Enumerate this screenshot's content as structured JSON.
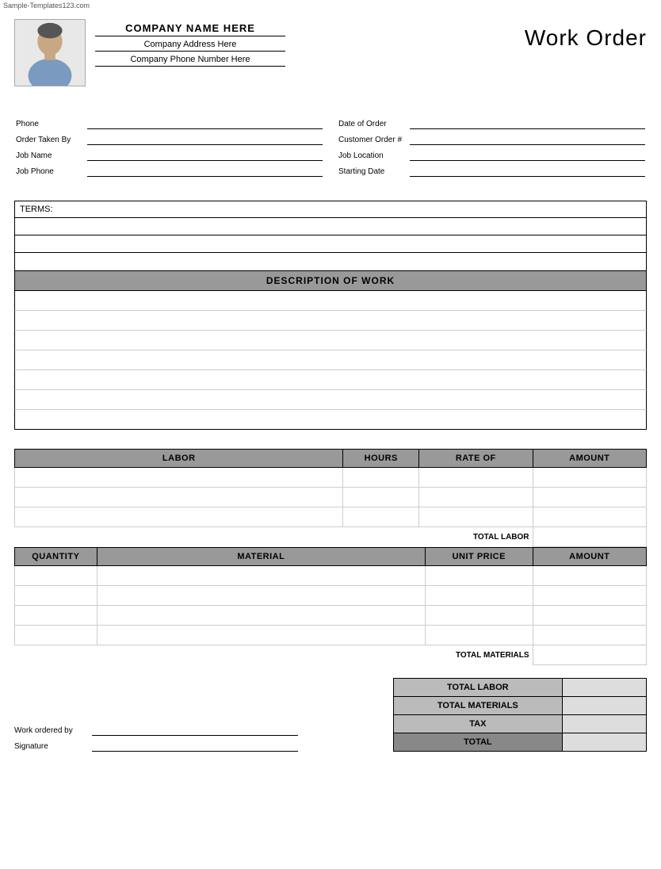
{
  "watermark": "Sample-Templates123.com",
  "header": {
    "company_name": "COMPANY NAME HERE",
    "company_address": "Company Address Here",
    "company_phone": "Company Phone Number Here",
    "title": "Work Order"
  },
  "form": {
    "left": [
      {
        "label": "Phone",
        "value": ""
      },
      {
        "label": "Order Taken By",
        "value": ""
      },
      {
        "label": "Job Name",
        "value": ""
      },
      {
        "label": "Job Phone",
        "value": ""
      }
    ],
    "right": [
      {
        "label": "Date of Order",
        "value": ""
      },
      {
        "label": "Customer Order #",
        "value": ""
      },
      {
        "label": "Job Location",
        "value": ""
      },
      {
        "label": "Starting Date",
        "value": ""
      }
    ]
  },
  "terms": {
    "label": "TERMS:",
    "rows": 3
  },
  "description_of_work": {
    "header": "DESCRIPTION OF WORK",
    "rows": 7
  },
  "labor": {
    "columns": [
      "LABOR",
      "HOURS",
      "RATE OF",
      "AMOUNT"
    ],
    "rows": 3,
    "total_label": "TOTAL LABOR"
  },
  "materials": {
    "columns": [
      "QUANTITY",
      "MATERIAL",
      "UNIT PRICE",
      "AMOUNT"
    ],
    "rows": 4,
    "total_label": "TOTAL MATERIALS"
  },
  "summary": {
    "rows": [
      {
        "label": "TOTAL LABOR",
        "value": ""
      },
      {
        "label": "TOTAL MATERIALS",
        "value": ""
      },
      {
        "label": "TAX",
        "value": ""
      },
      {
        "label": "TOTAL",
        "value": "",
        "bold": true
      }
    ]
  },
  "signature": {
    "work_ordered_by_label": "Work ordered by",
    "signature_label": "Signature"
  }
}
